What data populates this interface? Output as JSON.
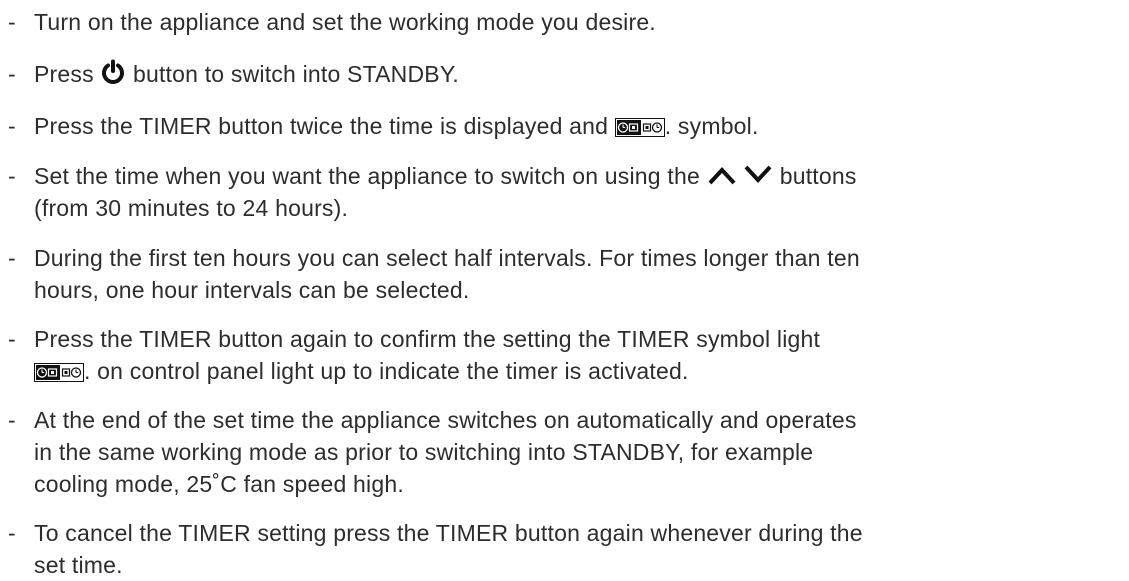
{
  "steps": [
    {
      "text": "Turn on the appliance and set the working mode you desire."
    },
    {
      "before": "Press",
      "after": "button to switch into STANDBY."
    },
    {
      "before": "Press the TIMER button twice the time is displayed and",
      "after": ". symbol."
    },
    {
      "line1_before": "Set the time when you want the appliance to switch on using the",
      "line1_after": "buttons",
      "line2": "(from 30 minutes to 24 hours)."
    },
    {
      "line1": "During the first ten hours you can select half intervals. For times longer than ten",
      "line2": "hours, one hour intervals can be selected."
    },
    {
      "line1": "Press the TIMER button again to confirm the setting the TIMER symbol light",
      "line2_after": ". on control panel light up to indicate the timer is activated."
    },
    {
      "line1": "At the end of the set time the appliance switches on automatically and operates",
      "line2": "in the same working mode as prior to switching into STANDBY, for example",
      "line3": "cooling mode, 25˚C fan speed high."
    },
    {
      "line1": "To cancel the TIMER setting press the TIMER button again whenever during the",
      "line2": "set time."
    }
  ],
  "bullet": "-",
  "icons": {
    "power": "power-icon",
    "timer": "timer-display-icon",
    "up": "up-arrow-icon",
    "down": "down-arrow-icon"
  },
  "colors": {
    "text": "#2d2d2d",
    "icon": "#111111"
  }
}
